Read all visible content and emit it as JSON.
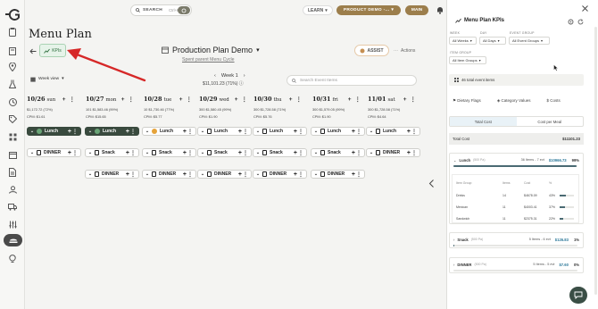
{
  "topbar": {
    "search_label": "SEARCH",
    "search_shortcut": "Ctrl+K",
    "learn_label": "LEARN",
    "prod_demo_label": "PRODUCT DEMO -...",
    "main_label": "MAIN",
    "avatar_initial": "F"
  },
  "page": {
    "title": "Menu Plan",
    "kpis_label": "KPIs",
    "plan_name": "Production Plan Demo",
    "parent_link": "Spent parent Menu Cycle",
    "assist_label": "ASSIST",
    "actions_label": "Actions",
    "week_view_label": "Week view",
    "week_label": "Week 1",
    "week_cost": "$11,101.23 (71%)",
    "event_search_placeholder": "Search Event Items"
  },
  "days": [
    {
      "date": "10/26",
      "dow": "sun",
      "amt": "$1,172.72 (72%)",
      "cpm": "CPM: $1.61"
    },
    {
      "date": "10/27",
      "dow": "mon",
      "amt": "101  $1,583.46 (99%)",
      "cpm": "CPM: $15.65"
    },
    {
      "date": "10/28",
      "dow": "tue",
      "amt": "10  $1,730.46 (77%)",
      "cpm": "CPM: $5.77"
    },
    {
      "date": "10/29",
      "dow": "wed",
      "amt": "300  $1,580.45 (99%)",
      "cpm": "CPM: $1.90"
    },
    {
      "date": "10/30",
      "dow": "thu",
      "amt": "300  $1,728.58 (71%)",
      "cpm": "CPM: $5.76"
    },
    {
      "date": "10/31",
      "dow": "fri",
      "amt": "300  $1,579.05 (99%)",
      "cpm": "CPM: $1.90"
    },
    {
      "date": "11/01",
      "dow": "sat",
      "amt": "300  $1,728.58 (71%)",
      "cpm": "CPM: $4.64"
    }
  ],
  "meals_row1": [
    {
      "label": "Lunch",
      "style": "dark",
      "mark": "check"
    },
    {
      "label": "Lunch",
      "style": "dark",
      "mark": "check"
    },
    {
      "label": "Lunch",
      "style": "light",
      "mark": "dot"
    },
    {
      "label": "Lunch",
      "style": "light",
      "mark": "doc"
    },
    {
      "label": "Lunch",
      "style": "light",
      "mark": "doc"
    },
    {
      "label": "Lunch",
      "style": "light",
      "mark": "doc"
    },
    {
      "label": "Lunch",
      "style": "light",
      "mark": "doc"
    }
  ],
  "meals_row2": [
    {
      "label": "DINNER",
      "mark": "doc"
    },
    {
      "label": "Snack",
      "mark": "doc"
    },
    {
      "label": "Snack",
      "mark": "doc"
    },
    {
      "label": "Snack",
      "mark": "doc"
    },
    {
      "label": "Snack",
      "mark": "doc"
    },
    {
      "label": "Snack",
      "mark": "doc"
    },
    {
      "label": "DINNER",
      "mark": "doc"
    }
  ],
  "meals_row3": [
    {
      "label": "DINNER",
      "mark": "doc"
    },
    {
      "label": "DINNER",
      "mark": "doc"
    },
    {
      "label": "DINNER",
      "mark": "doc"
    },
    {
      "label": "DINNER",
      "mark": "doc"
    },
    {
      "label": "DINNER",
      "mark": "doc"
    }
  ],
  "panel": {
    "title": "Menu Plan KPIs",
    "week_field": "WEEK",
    "week_value": "All Weeks",
    "day_field": "DAY",
    "day_value": "All Days",
    "event_group_field": "EVENT GROUP",
    "event_group_value": "All Event Groups",
    "item_group_field": "ITEM GROUP",
    "item_group_value": "All Item Groups",
    "total_events": "46 total event items",
    "tab_dietary": "Dietary Flags",
    "tab_category": "Category Values",
    "tab_costs": "Costs",
    "seg_total": "Total Cost",
    "seg_per_meal": "Cost per Meal",
    "total_cost_label": "Total Cost",
    "total_cost_value": "$11101.23",
    "lunch": {
      "name": "Lunch",
      "meta": "(500 Pa)",
      "items": "36 Items - 7 evt",
      "cost": "$10966.73",
      "pct": "99%",
      "fill": 0.99
    },
    "snack": {
      "name": "Snack",
      "meta": "(500 Pa)",
      "items": "5 Items - 6 evt",
      "cost": "$126.83",
      "pct": "1%",
      "fill": 0.01
    },
    "dinner": {
      "name": "DINNER",
      "meta": "(500 Pa)",
      "items": "5 Items - 5 evt",
      "cost": "$7.60",
      "pct": "0%",
      "fill": 0.0
    },
    "table_headers": [
      "Item Group",
      "Items",
      "Cost",
      "%"
    ],
    "table_rows": [
      {
        "group": "Drinks",
        "items": "14",
        "cost": "$4678.09",
        "pct": "43%",
        "fill": 0.43
      },
      {
        "group": "Mexican",
        "items": "11",
        "cost": "$4003.41",
        "pct": "37%",
        "fill": 0.37
      },
      {
        "group": "Sandwich",
        "items": "11",
        "cost": "$2375.31",
        "pct": "22%",
        "fill": 0.22
      }
    ]
  },
  "colors": {
    "accent_gold": "#9c7e4c",
    "dark_green": "#394a3e",
    "kpi_green": "#6aa577",
    "arrow_red": "#d62828"
  }
}
